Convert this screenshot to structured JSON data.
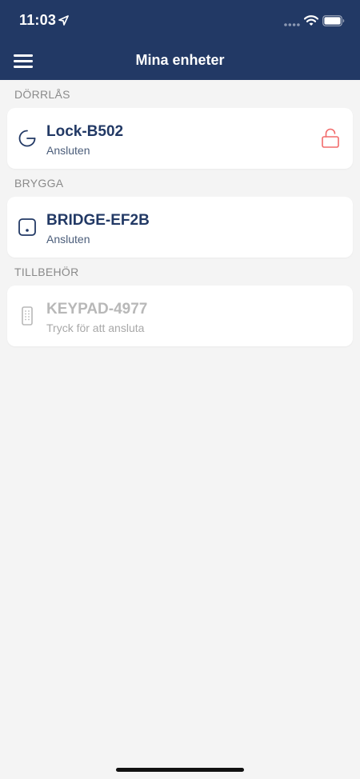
{
  "status_bar": {
    "time": "11:03"
  },
  "nav": {
    "title": "Mina enheter",
    "menu_icon": "hamburger-menu-icon"
  },
  "sections": [
    {
      "title": "DÖRRLÅS",
      "device": {
        "name": "Lock-B502",
        "status": "Ansluten",
        "icon": "lock-device-icon",
        "state_icon": "unlocked-padlock-icon"
      }
    },
    {
      "title": "BRYGGA",
      "device": {
        "name": "BRIDGE-EF2B",
        "status": "Ansluten",
        "icon": "bridge-device-icon"
      }
    },
    {
      "title": "TILLBEHÖR",
      "device": {
        "name": "KEYPAD-4977",
        "status": "Tryck för att ansluta",
        "icon": "keypad-device-icon"
      }
    }
  ],
  "colors": {
    "header_bg": "#223965",
    "page_bg": "#f4f4f4",
    "card_bg": "#ffffff",
    "title_text": "#223965",
    "alert_red": "#f26b6b",
    "disabled_text": "#b8b8b8"
  }
}
